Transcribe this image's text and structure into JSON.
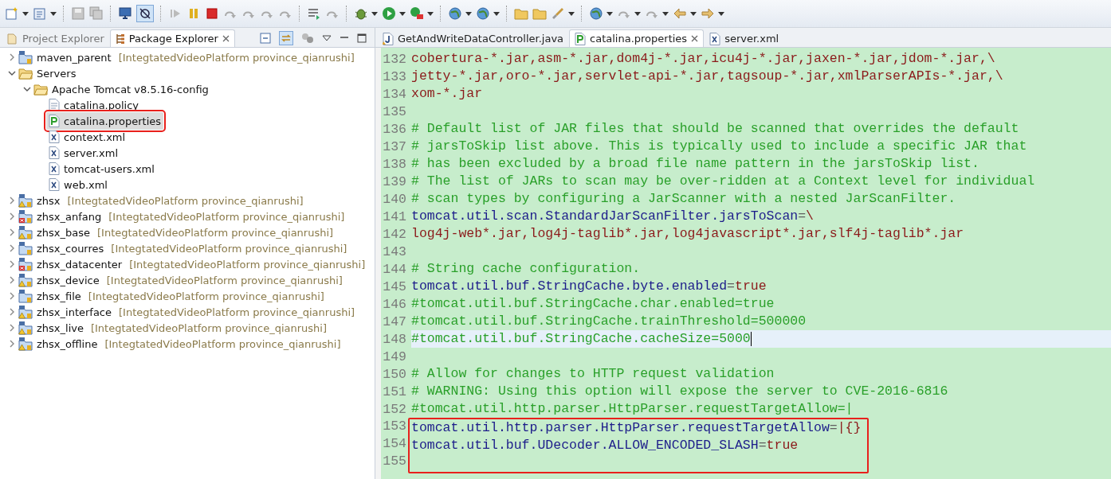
{
  "explorer": {
    "tabs": [
      {
        "label": "Project Explorer",
        "selected": false
      },
      {
        "label": "Package Explorer",
        "selected": true
      }
    ],
    "tree": [
      {
        "kind": "project",
        "label": "maven_parent",
        "info": "[IntegtatedVideoPlatform province_qianrushi]",
        "expanded": false,
        "selected": false,
        "boxed": false
      },
      {
        "kind": "folder",
        "label": "Servers",
        "expanded": true,
        "selected": false,
        "boxed": false,
        "children": [
          {
            "kind": "folder",
            "label": "Apache Tomcat v8.5.16-config",
            "expanded": true,
            "selected": false,
            "boxed": false,
            "children": [
              {
                "kind": "text-file",
                "label": "catalina.policy",
                "selected": false,
                "boxed": false
              },
              {
                "kind": "properties-file",
                "label": "catalina.properties",
                "selected": true,
                "boxed": true
              },
              {
                "kind": "xml-file",
                "label": "context.xml",
                "selected": false,
                "boxed": false
              },
              {
                "kind": "xml-file",
                "label": "server.xml",
                "selected": false,
                "boxed": false
              },
              {
                "kind": "xml-file",
                "label": "tomcat-users.xml",
                "selected": false,
                "boxed": false
              },
              {
                "kind": "xml-file",
                "label": "web.xml",
                "selected": false,
                "boxed": false
              }
            ]
          }
        ]
      },
      {
        "kind": "project-warning",
        "label": "zhsx",
        "info": "[IntegtatedVideoPlatform province_qianrushi]",
        "expanded": false,
        "selected": false,
        "boxed": false
      },
      {
        "kind": "project-error",
        "label": "zhsx_anfang",
        "info": "[IntegtatedVideoPlatform province_qianrushi]",
        "expanded": false,
        "selected": false,
        "boxed": false
      },
      {
        "kind": "project-warning",
        "label": "zhsx_base",
        "info": "[IntegtatedVideoPlatform province_qianrushi]",
        "expanded": false,
        "selected": false,
        "boxed": false
      },
      {
        "kind": "project",
        "label": "zhsx_courres",
        "info": "[IntegtatedVideoPlatform province_qianrushi]",
        "expanded": false,
        "selected": false,
        "boxed": false
      },
      {
        "kind": "project-error",
        "label": "zhsx_datacenter",
        "info": "[IntegtatedVideoPlatform province_qianrushi]",
        "expanded": false,
        "selected": false,
        "boxed": false
      },
      {
        "kind": "project-warning",
        "label": "zhsx_device",
        "info": "[IntegtatedVideoPlatform province_qianrushi]",
        "expanded": false,
        "selected": false,
        "boxed": false
      },
      {
        "kind": "project",
        "label": "zhsx_file",
        "info": "[IntegtatedVideoPlatform province_qianrushi]",
        "expanded": false,
        "selected": false,
        "boxed": false
      },
      {
        "kind": "project-warning",
        "label": "zhsx_interface",
        "info": "[IntegtatedVideoPlatform province_qianrushi]",
        "expanded": false,
        "selected": false,
        "boxed": false
      },
      {
        "kind": "project-warning",
        "label": "zhsx_live",
        "info": "[IntegtatedVideoPlatform province_qianrushi]",
        "expanded": false,
        "selected": false,
        "boxed": false
      },
      {
        "kind": "project-warning",
        "label": "zhsx_offline",
        "info": "[IntegtatedVideoPlatform province_qianrushi]",
        "expanded": false,
        "selected": false,
        "boxed": false
      }
    ]
  },
  "editor": {
    "tabs": [
      {
        "label": "GetAndWriteDataController.java",
        "kind": "java-file",
        "selected": false
      },
      {
        "label": "catalina.properties",
        "kind": "properties-file",
        "selected": true
      },
      {
        "label": "server.xml",
        "kind": "xml-file",
        "selected": false
      }
    ],
    "lines": [
      {
        "number": "132",
        "kind": "value",
        "text": "cobertura-*.jar,asm-*.jar,dom4j-*.jar,icu4j-*.jar,jaxen-*.jar,jdom-*.jar,\\",
        "current": false,
        "boxed": false
      },
      {
        "number": "133",
        "kind": "value",
        "text": "jetty-*.jar,oro-*.jar,servlet-api-*.jar,tagsoup-*.jar,xmlParserAPIs-*.jar,\\",
        "current": false,
        "boxed": false
      },
      {
        "number": "134",
        "kind": "value",
        "text": "xom-*.jar",
        "current": false,
        "boxed": false
      },
      {
        "number": "135",
        "kind": "blank",
        "current": false,
        "boxed": false
      },
      {
        "number": "136",
        "kind": "comment",
        "text": "# Default list of JAR files that should be scanned that overrides the default",
        "current": false,
        "boxed": false
      },
      {
        "number": "137",
        "kind": "comment",
        "text": "# jarsToSkip list above. This is typically used to include a specific JAR that",
        "current": false,
        "boxed": false
      },
      {
        "number": "138",
        "kind": "comment",
        "text": "# has been excluded by a broad file name pattern in the jarsToSkip list.",
        "current": false,
        "boxed": false
      },
      {
        "number": "139",
        "kind": "comment",
        "text": "# The list of JARs to scan may be over-ridden at a Context level for individual",
        "current": false,
        "boxed": false
      },
      {
        "number": "140",
        "kind": "comment",
        "text": "# scan types by configuring a JarScanner with a nested JarScanFilter.",
        "current": false,
        "boxed": false
      },
      {
        "number": "141",
        "kind": "property",
        "key": "tomcat.util.scan.StandardJarScanFilter.jarsToScan",
        "sep": "=",
        "value": "\\",
        "current": false,
        "boxed": false
      },
      {
        "number": "142",
        "kind": "value",
        "text": "log4j-web*.jar,log4j-taglib*.jar,log4javascript*.jar,slf4j-taglib*.jar",
        "current": false,
        "boxed": false
      },
      {
        "number": "143",
        "kind": "blank",
        "current": false,
        "boxed": false
      },
      {
        "number": "144",
        "kind": "comment",
        "text": "# String cache configuration.",
        "current": false,
        "boxed": false
      },
      {
        "number": "145",
        "kind": "property",
        "key": "tomcat.util.buf.StringCache.byte.enabled",
        "sep": "=",
        "value": "true",
        "current": false,
        "boxed": false
      },
      {
        "number": "146",
        "kind": "comment",
        "text": "#tomcat.util.buf.StringCache.char.enabled=true",
        "current": false,
        "boxed": false
      },
      {
        "number": "147",
        "kind": "comment",
        "text": "#tomcat.util.buf.StringCache.trainThreshold=500000",
        "current": false,
        "boxed": false
      },
      {
        "number": "148",
        "kind": "comment",
        "text": "#tomcat.util.buf.StringCache.cacheSize=5000",
        "current": true,
        "boxed": false
      },
      {
        "number": "149",
        "kind": "blank",
        "current": false,
        "boxed": false
      },
      {
        "number": "150",
        "kind": "comment",
        "text": "# Allow for changes to HTTP request validation",
        "current": false,
        "boxed": false
      },
      {
        "number": "151",
        "kind": "comment",
        "text": "# WARNING: Using this option will expose the server to CVE-2016-6816",
        "current": false,
        "boxed": false
      },
      {
        "number": "152",
        "kind": "comment",
        "text": "#tomcat.util.http.parser.HttpParser.requestTargetAllow=|",
        "current": false,
        "boxed": false
      },
      {
        "number": "153",
        "kind": "property",
        "key": "tomcat.util.http.parser.HttpParser.requestTargetAllow",
        "sep": "=",
        "value": "|{}",
        "current": false,
        "boxed": true
      },
      {
        "number": "154",
        "kind": "property",
        "key": "tomcat.util.buf.UDecoder.ALLOW_ENCODED_SLASH",
        "sep": "=",
        "value": "true",
        "current": false,
        "boxed": true
      },
      {
        "number": "155",
        "kind": "blank",
        "current": false,
        "boxed": true
      }
    ]
  }
}
